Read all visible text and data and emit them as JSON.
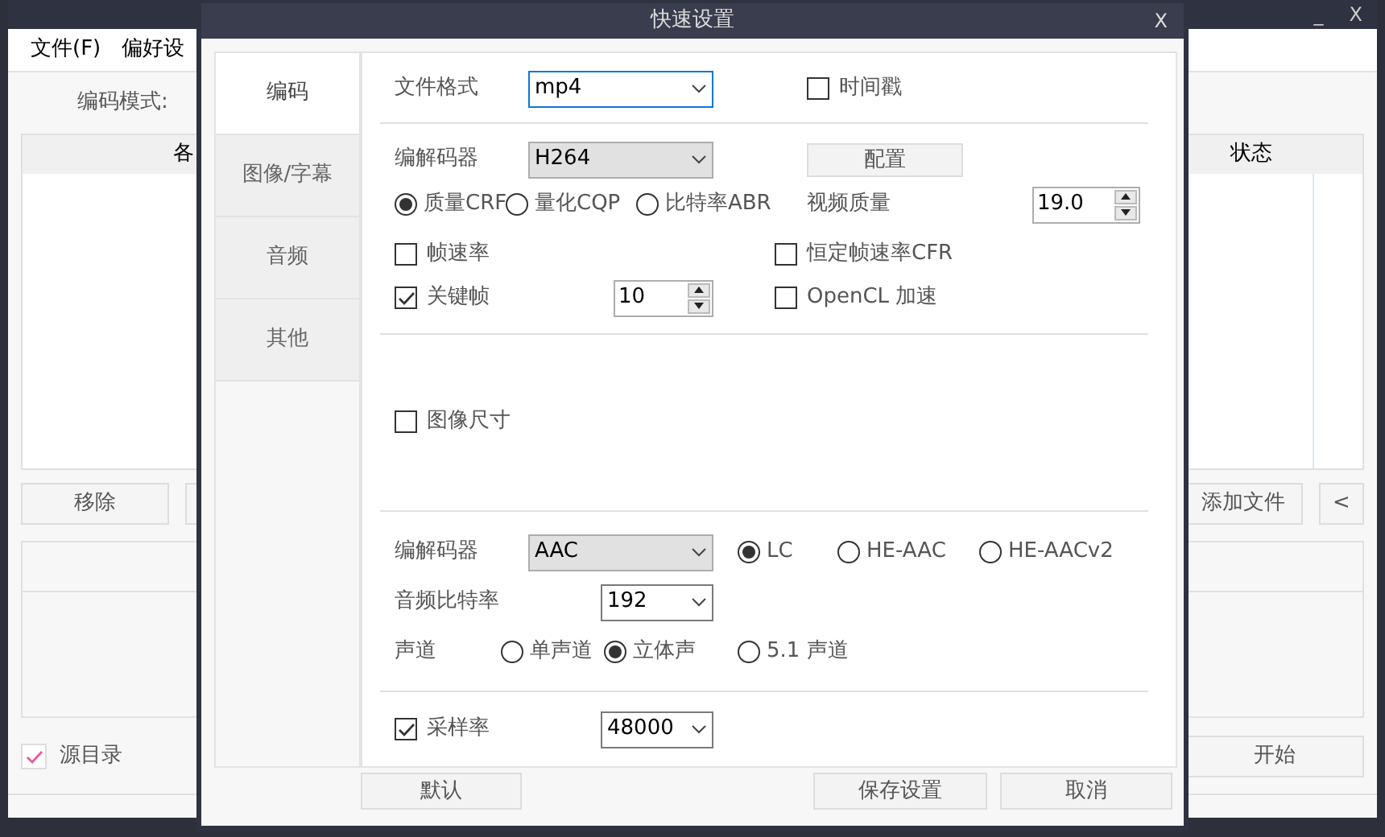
{
  "main_window": {
    "title_controls": [
      "_",
      "X"
    ],
    "menu": [
      "文件(F)",
      "偏好设"
    ],
    "encode_mode_label": "编码模式:",
    "table": {
      "columns": [
        "各",
        "状态"
      ]
    },
    "buttons": [
      "移除",
      "添加文件",
      "<"
    ],
    "source_dir": {
      "label": "源目录",
      "checked": true
    },
    "start_button": "开始"
  },
  "dialog": {
    "title": "快速设置",
    "close": "X",
    "tabs": [
      {
        "label": "编码",
        "selected": true
      },
      {
        "label": "图像/字幕",
        "selected": false
      },
      {
        "label": "音频",
        "selected": false
      },
      {
        "label": "其他",
        "selected": false
      }
    ],
    "format": {
      "label": "文件格式",
      "value": "mp4"
    },
    "timestamp": {
      "label": "时间戳",
      "checked": false
    },
    "video_codec": {
      "label": "编解码器",
      "value": "H264"
    },
    "config_button": "配置",
    "rate_modes": [
      {
        "label": "质量CRF",
        "selected": true
      },
      {
        "label": "量化CQP",
        "selected": false
      },
      {
        "label": "比特率ABR",
        "selected": false
      }
    ],
    "video_quality": {
      "label": "视频质量",
      "value": "19.0"
    },
    "frame_rate": {
      "label": "帧速率",
      "checked": false
    },
    "cfr": {
      "label": "恒定帧速率CFR",
      "checked": false
    },
    "keyframe": {
      "label": "关键帧",
      "checked": true,
      "value": "10"
    },
    "opencl": {
      "label": "OpenCL 加速",
      "checked": false
    },
    "image_size": {
      "label": "图像尺寸",
      "checked": false
    },
    "audio_codec": {
      "label": "编解码器",
      "value": "AAC"
    },
    "aac_profiles": [
      {
        "label": "LC",
        "selected": true
      },
      {
        "label": "HE-AAC",
        "selected": false
      },
      {
        "label": "HE-AACv2",
        "selected": false
      }
    ],
    "audio_bitrate": {
      "label": "音频比特率",
      "value": "192"
    },
    "channels": {
      "label": "声道",
      "options": [
        {
          "label": "单声道",
          "selected": false
        },
        {
          "label": "立体声",
          "selected": true
        },
        {
          "label": "5.1 声道",
          "selected": false
        }
      ]
    },
    "sample_rate": {
      "label": "采样率",
      "checked": true,
      "value": "48000"
    },
    "buttons": [
      "默认",
      "保存设置",
      "取消"
    ]
  }
}
